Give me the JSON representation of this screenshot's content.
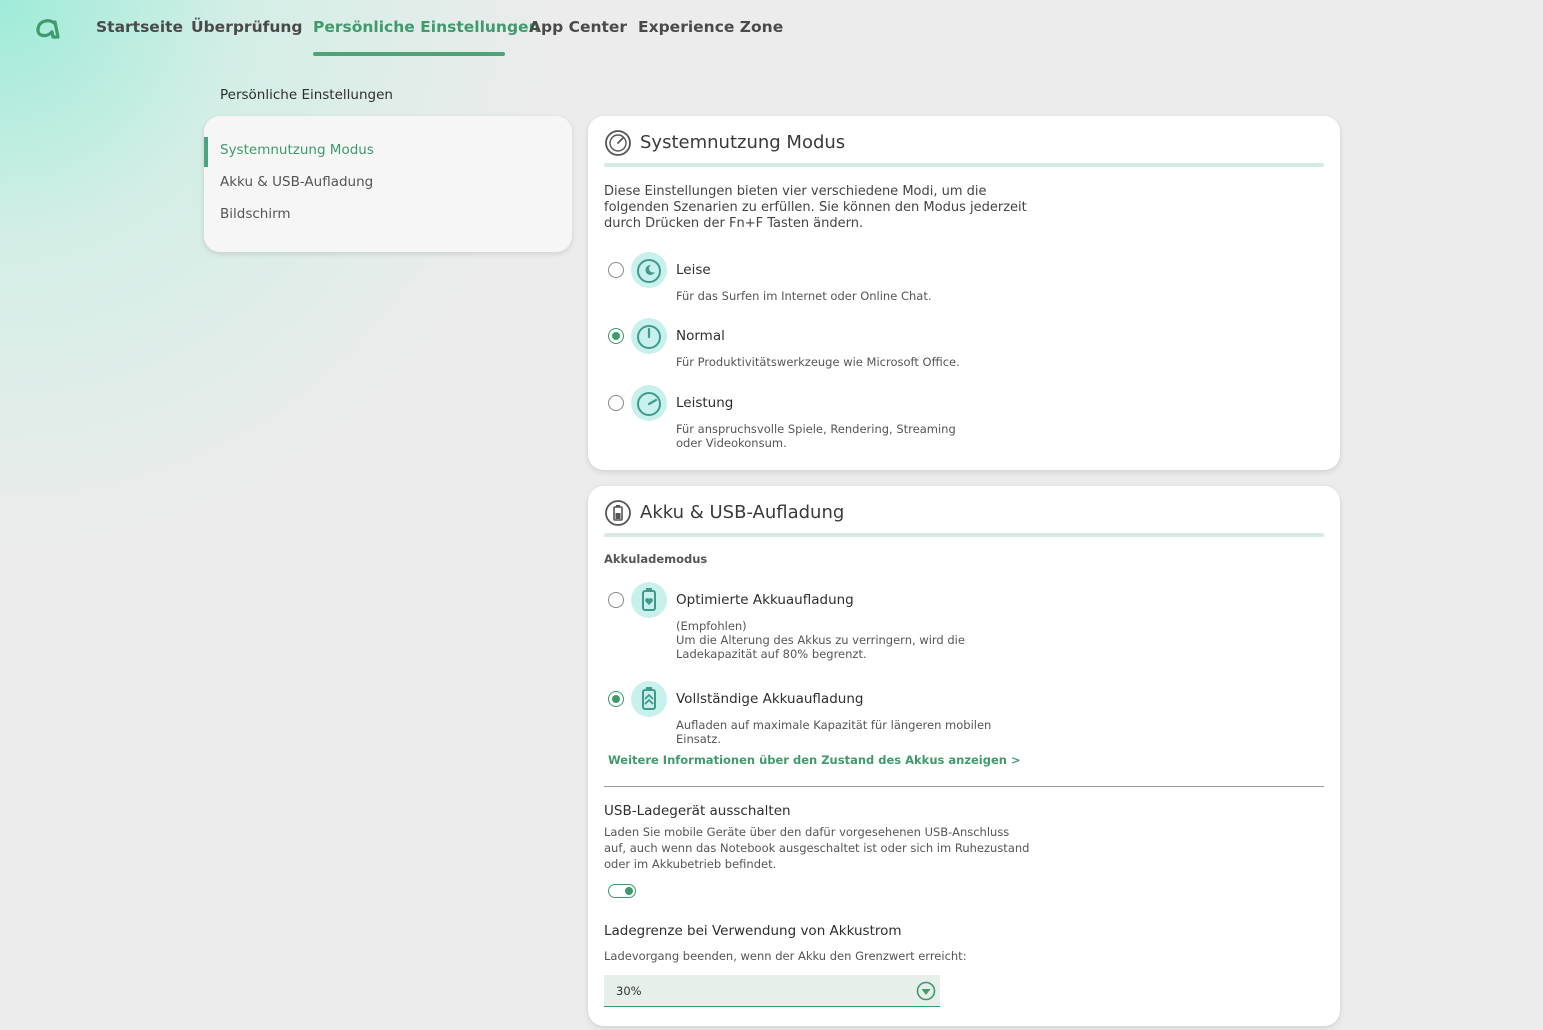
{
  "nav": {
    "logo": "acer-logo",
    "tabs": [
      {
        "label": "Startseite"
      },
      {
        "label": "Überprüfung"
      },
      {
        "label": "Persönliche Einstellungen",
        "active": true
      },
      {
        "label": "App Center"
      },
      {
        "label": "Experience Zone"
      }
    ]
  },
  "page_heading": "Persönliche Einstellungen",
  "sidebar": {
    "items": [
      {
        "label": "Systemnutzung Modus",
        "active": true
      },
      {
        "label": "Akku & USB-Aufladung"
      },
      {
        "label": "Bildschirm"
      }
    ]
  },
  "mode_card": {
    "title": "Systemnutzung Modus",
    "icon": "gauge-icon",
    "description": "Diese Einstellungen bieten vier verschiedene Modi, um die folgenden Szenarien zu erfüllen. Sie können den Modus jederzeit durch Drücken der Fn+F Tasten ändern.",
    "options": [
      {
        "label": "Leise",
        "description": "Für das Surfen im Internet oder Online Chat.",
        "icon": "quiet-gauge-icon",
        "selected": false
      },
      {
        "label": "Normal",
        "description": "Für Produktivitätswerkzeuge wie Microsoft Office.",
        "icon": "normal-gauge-icon",
        "selected": true
      },
      {
        "label": "Leistung",
        "description": "Für anspruchsvolle Spiele, Rendering, Streaming oder Videokonsum.",
        "icon": "performance-gauge-icon",
        "selected": false
      }
    ]
  },
  "battery_card": {
    "title": "Akku & USB-Aufladung",
    "icon": "battery-icon",
    "mode_label": "Akkulademodus",
    "options": [
      {
        "label": "Optimierte Akkuaufladung",
        "description": "(Empfohlen)\nUm die Alterung des Akkus zu verringern, wird die Ladekapazität auf 80% begrenzt.",
        "icon": "battery-heart-icon",
        "selected": false
      },
      {
        "label": "Vollständige Akkuaufladung",
        "description": "Aufladen auf maximale Kapazität für längeren mobilen Einsatz.",
        "icon": "battery-full-icon",
        "selected": true
      }
    ],
    "more_link": "Weitere Informationen über den Zustand des Akkus anzeigen >",
    "usb": {
      "title": "USB-Ladegerät ausschalten",
      "description": "Laden Sie mobile Geräte über den dafür vorgesehenen USB-Anschluss auf, auch wenn das Notebook ausgeschaltet ist oder sich im Ruhezustand oder im Akkubetrieb befindet.",
      "toggle_on": true
    },
    "limit": {
      "title": "Ladegrenze bei Verwendung von Akkustrom",
      "description": "Ladevorgang beenden, wenn der Akku den Grenzwert erreicht:",
      "selected_value": "30%"
    }
  },
  "colors": {
    "accent": "#3f9a6c",
    "accent_light": "#d5ebe2",
    "icon_bg": "#c8f0ec"
  }
}
